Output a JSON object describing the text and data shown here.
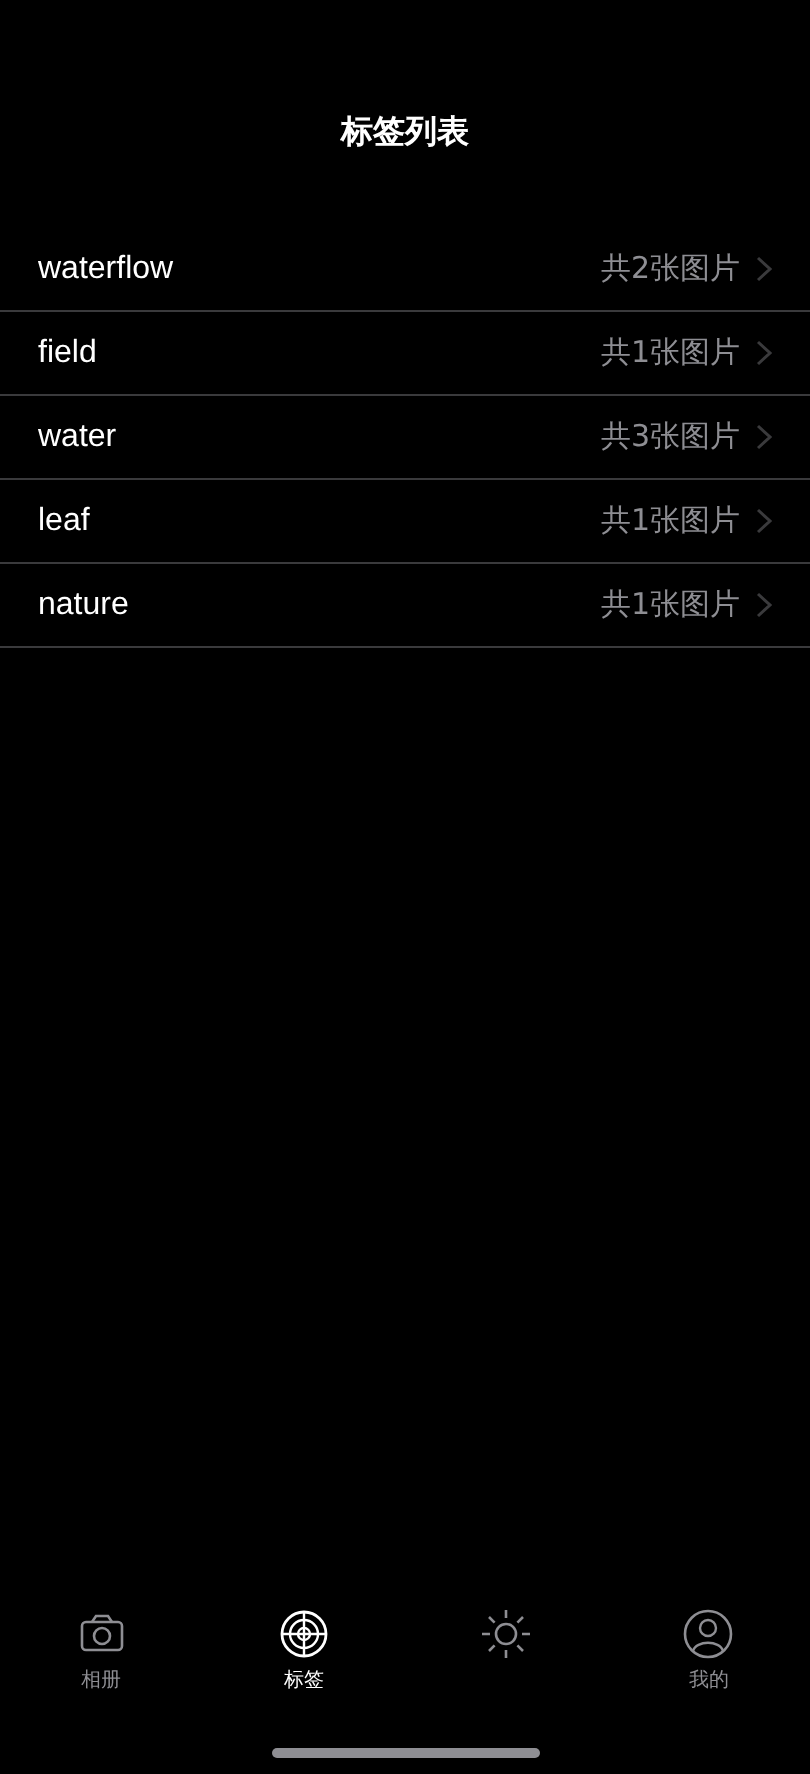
{
  "title": "标签列表",
  "tags": [
    {
      "name": "waterflow",
      "count": "共2张图片"
    },
    {
      "name": "field",
      "count": "共1张图片"
    },
    {
      "name": "water",
      "count": "共3张图片"
    },
    {
      "name": "leaf",
      "count": "共1张图片"
    },
    {
      "name": "nature",
      "count": "共1张图片"
    }
  ],
  "tab_bar": [
    {
      "kind": "camera",
      "label": "相册",
      "selected": false
    },
    {
      "kind": "target",
      "label": "标签",
      "selected": true
    },
    {
      "kind": "sun",
      "selected": false
    },
    {
      "kind": "person",
      "label": "我的",
      "selected": false
    }
  ]
}
